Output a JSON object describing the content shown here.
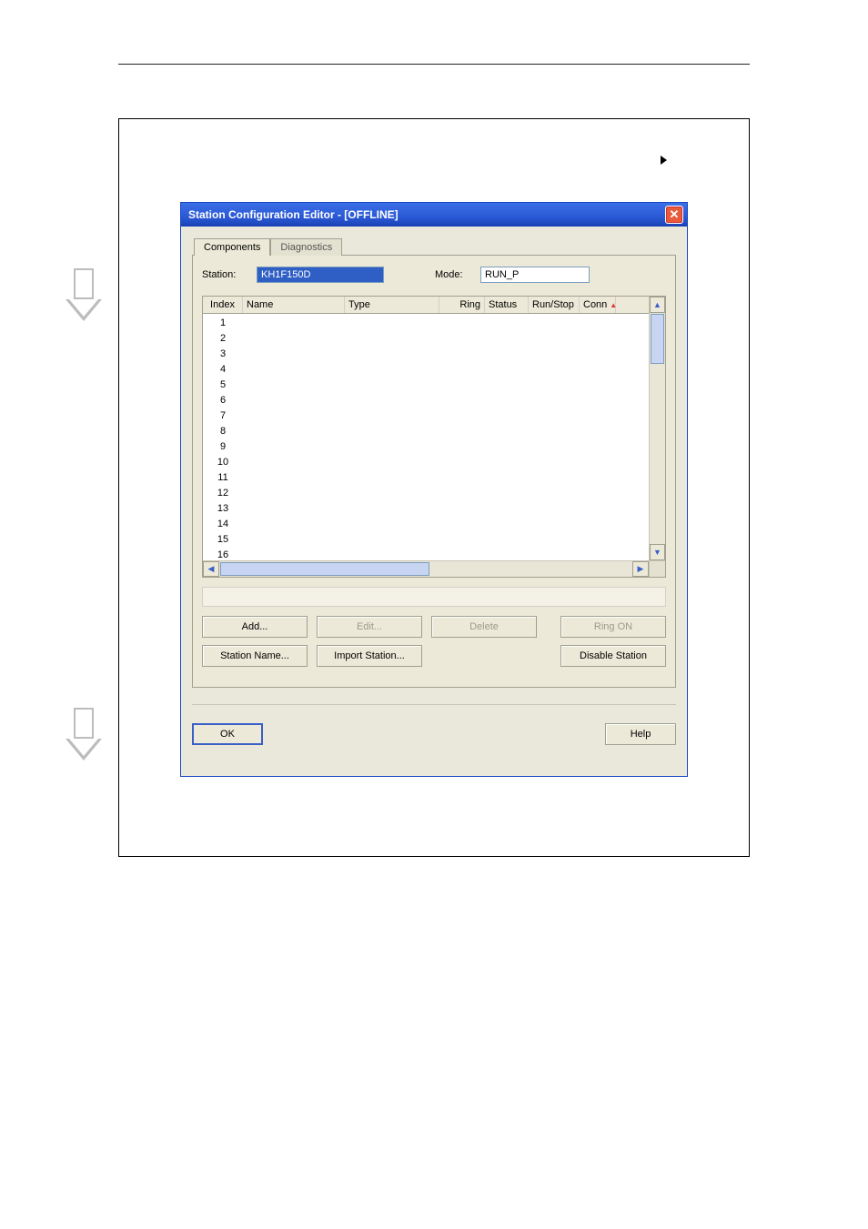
{
  "dialog": {
    "title": "Station Configuration Editor - [OFFLINE]",
    "tabs": {
      "components": "Components",
      "diagnostics": "Diagnostics"
    },
    "station_label": "Station:",
    "station_value": "KH1F150D",
    "mode_label": "Mode:",
    "mode_value": "RUN_P",
    "columns": {
      "index": "Index",
      "name": "Name",
      "type": "Type",
      "ring": "Ring",
      "status": "Status",
      "runstop": "Run/Stop",
      "conn": "Conn"
    },
    "rows": [
      "1",
      "2",
      "3",
      "4",
      "5",
      "6",
      "7",
      "8",
      "9",
      "10",
      "11",
      "12",
      "13",
      "14",
      "15",
      "16"
    ],
    "buttons": {
      "add": "Add...",
      "edit": "Edit...",
      "delete": "Delete",
      "ring_on": "Ring ON",
      "station_name": "Station Name...",
      "import_station": "Import Station...",
      "disable_station": "Disable Station",
      "ok": "OK",
      "help": "Help"
    }
  }
}
